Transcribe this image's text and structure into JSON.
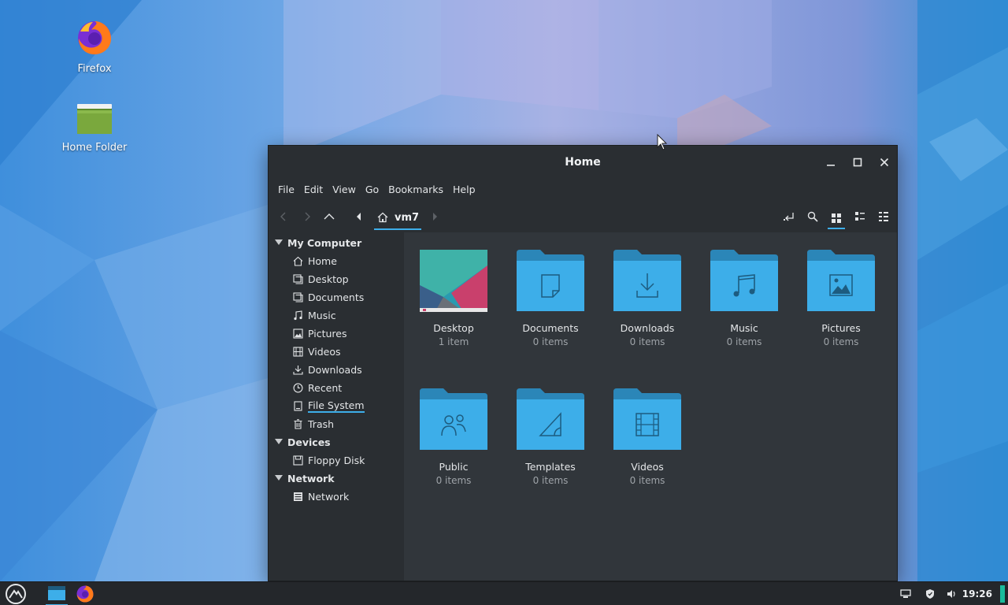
{
  "desktop": {
    "icons": [
      {
        "label": "Firefox",
        "icon": "firefox-icon"
      },
      {
        "label": "Home Folder",
        "icon": "folder-icon"
      }
    ]
  },
  "window": {
    "title": "Home",
    "controls": {
      "minimize": "minimize-icon",
      "maximize": "maximize-icon",
      "close": "close-icon"
    },
    "menu": [
      "File",
      "Edit",
      "View",
      "Go",
      "Bookmarks",
      "Help"
    ],
    "toolbar": {
      "breadcrumb": "vm7",
      "left_icons": [
        "back-icon",
        "forward-icon",
        "up-icon",
        "prev-crumb-icon"
      ],
      "right_icons": [
        "terminal-icon",
        "search-icon",
        "icon-view-icon",
        "compact-view-icon",
        "detail-view-icon"
      ]
    },
    "sidebar": {
      "groups": [
        {
          "label": "My Computer",
          "items": [
            {
              "label": "Home",
              "icon": "home-icon"
            },
            {
              "label": "Desktop",
              "icon": "desktop-icon"
            },
            {
              "label": "Documents",
              "icon": "documents-icon"
            },
            {
              "label": "Music",
              "icon": "music-icon"
            },
            {
              "label": "Pictures",
              "icon": "pictures-icon"
            },
            {
              "label": "Videos",
              "icon": "videos-icon"
            },
            {
              "label": "Downloads",
              "icon": "downloads-icon"
            },
            {
              "label": "Recent",
              "icon": "recent-icon"
            },
            {
              "label": "File System",
              "icon": "filesystem-icon",
              "active": true
            },
            {
              "label": "Trash",
              "icon": "trash-icon"
            }
          ]
        },
        {
          "label": "Devices",
          "items": [
            {
              "label": "Floppy Disk",
              "icon": "floppy-icon"
            }
          ]
        },
        {
          "label": "Network",
          "items": [
            {
              "label": "Network",
              "icon": "network-icon"
            }
          ]
        }
      ]
    },
    "files": [
      {
        "name": "Desktop",
        "count": "1 item",
        "icon": "desktop-thumbnail"
      },
      {
        "name": "Documents",
        "count": "0 items",
        "icon": "folder-documents-icon"
      },
      {
        "name": "Downloads",
        "count": "0 items",
        "icon": "folder-downloads-icon"
      },
      {
        "name": "Music",
        "count": "0 items",
        "icon": "folder-music-icon"
      },
      {
        "name": "Pictures",
        "count": "0 items",
        "icon": "folder-pictures-icon"
      },
      {
        "name": "Public",
        "count": "0 items",
        "icon": "folder-public-icon"
      },
      {
        "name": "Templates",
        "count": "0 items",
        "icon": "folder-templates-icon"
      },
      {
        "name": "Videos",
        "count": "0 items",
        "icon": "folder-videos-icon"
      }
    ]
  },
  "taskbar": {
    "clock": "19:26",
    "tray_icons": [
      "network-tray-icon",
      "shield-tray-icon",
      "volume-tray-icon"
    ]
  },
  "colors": {
    "accent": "#3daee9",
    "folder": "#3daee9",
    "folder_tab": "#2b86b8",
    "window_bg": "#2a2e32",
    "content_bg": "#31363b"
  }
}
